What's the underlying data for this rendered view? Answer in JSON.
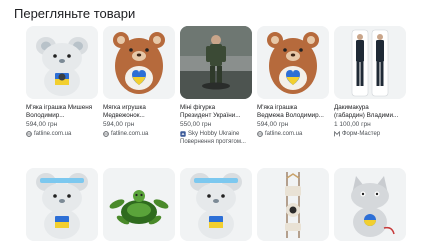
{
  "section": {
    "heading": "Перегляньте товари"
  },
  "products_row1": [
    {
      "title": "М'яка іграшка Мишеня\nВолодимир...",
      "price": "594,00 грн",
      "merchant": "fatline.com.ua",
      "merchant_icon": "globe-icon",
      "extra": ""
    },
    {
      "title": "Мягка игрушка\nМедвежонок...",
      "price": "594,00 грн",
      "merchant": "fatline.com.ua",
      "merchant_icon": "globe-icon",
      "extra": ""
    },
    {
      "title": "Міні фігурка\nПрезидент України...",
      "price": "550,00 грн",
      "merchant": "Sky Hobby Ukraine",
      "merchant_icon": "store-logo-icon",
      "extra": "Повернення протягом..."
    },
    {
      "title": "М'яка іграшка\nВедмежа Володимир...",
      "price": "594,00 грн",
      "merchant": "fatline.com.ua",
      "merchant_icon": "globe-icon",
      "extra": ""
    },
    {
      "title": "Дакимакура\n(габардин) Владими...",
      "price": "1 100,00 грн",
      "merchant": "Форм-Мастер",
      "merchant_icon": "m-logo-icon",
      "extra": ""
    }
  ],
  "colors": {
    "thumb_bg": "#f1f3f4",
    "text_primary": "#202124",
    "text_secondary": "#4d5156",
    "merchant_blue": "#1a73e8"
  }
}
